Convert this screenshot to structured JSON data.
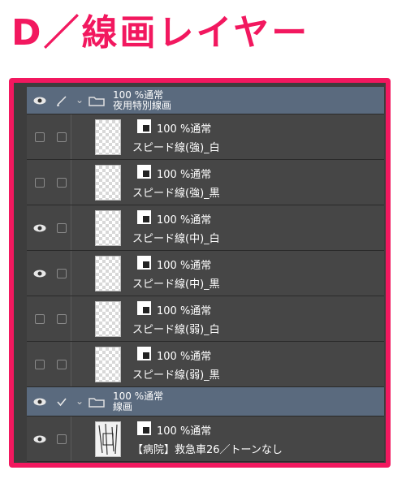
{
  "heading": "D／線画レイヤー",
  "colors": {
    "accent": "#f2185f",
    "folder_bg": "#5a6a7e",
    "panel_bg": "#464646"
  },
  "folders": [
    {
      "blend": "100 %通常",
      "name": "夜用特別線画",
      "eye_visible": true,
      "tool_icon": "pen-icon"
    },
    {
      "blend": "100 %通常",
      "name": "線画",
      "eye_visible": true,
      "tool_icon": "check-icon"
    }
  ],
  "layers": [
    {
      "blend": "100 %通常",
      "name": "スピード線(強)_白",
      "eye_visible": false
    },
    {
      "blend": "100 %通常",
      "name": "スピード線(強)_黒",
      "eye_visible": false
    },
    {
      "blend": "100 %通常",
      "name": "スピード線(中)_白",
      "eye_visible": true
    },
    {
      "blend": "100 %通常",
      "name": "スピード線(中)_黒",
      "eye_visible": true
    },
    {
      "blend": "100 %通常",
      "name": "スピード線(弱)_白",
      "eye_visible": false
    },
    {
      "blend": "100 %通常",
      "name": "スピード線(弱)_黒",
      "eye_visible": false
    },
    {
      "blend": "100 %通常",
      "name": "【病院】救急車26／トーンなし",
      "eye_visible": true
    }
  ]
}
